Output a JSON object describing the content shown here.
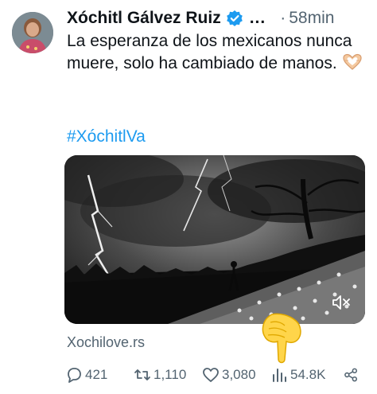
{
  "post": {
    "author_name": "Xóchitl Gálvez Ruiz",
    "more": "...",
    "separator": "·",
    "time": "58min",
    "text": "La esperanza de los mexicanos nunca muere, solo ha cambiado de manos.",
    "hashtag": "#XóchitlVa",
    "link": "Xochilove.rs"
  },
  "actions": {
    "replies": "421",
    "reposts": "1,110",
    "likes": "3,080",
    "views": "54.8K"
  },
  "icons": {
    "verified": "verified-badge-icon",
    "emoji_text": "heart-hands-emoji",
    "overlay": "backhand-index-pointing-down-emoji",
    "mute": "speaker-muted-icon",
    "reply": "reply-bubble-icon",
    "repost": "repost-icon",
    "like": "heart-icon",
    "views": "views-bar-chart-icon",
    "share": "share-icon"
  },
  "colors": {
    "accent": "#1d9bf0",
    "text": "#0f1419",
    "secondary": "#536471"
  }
}
